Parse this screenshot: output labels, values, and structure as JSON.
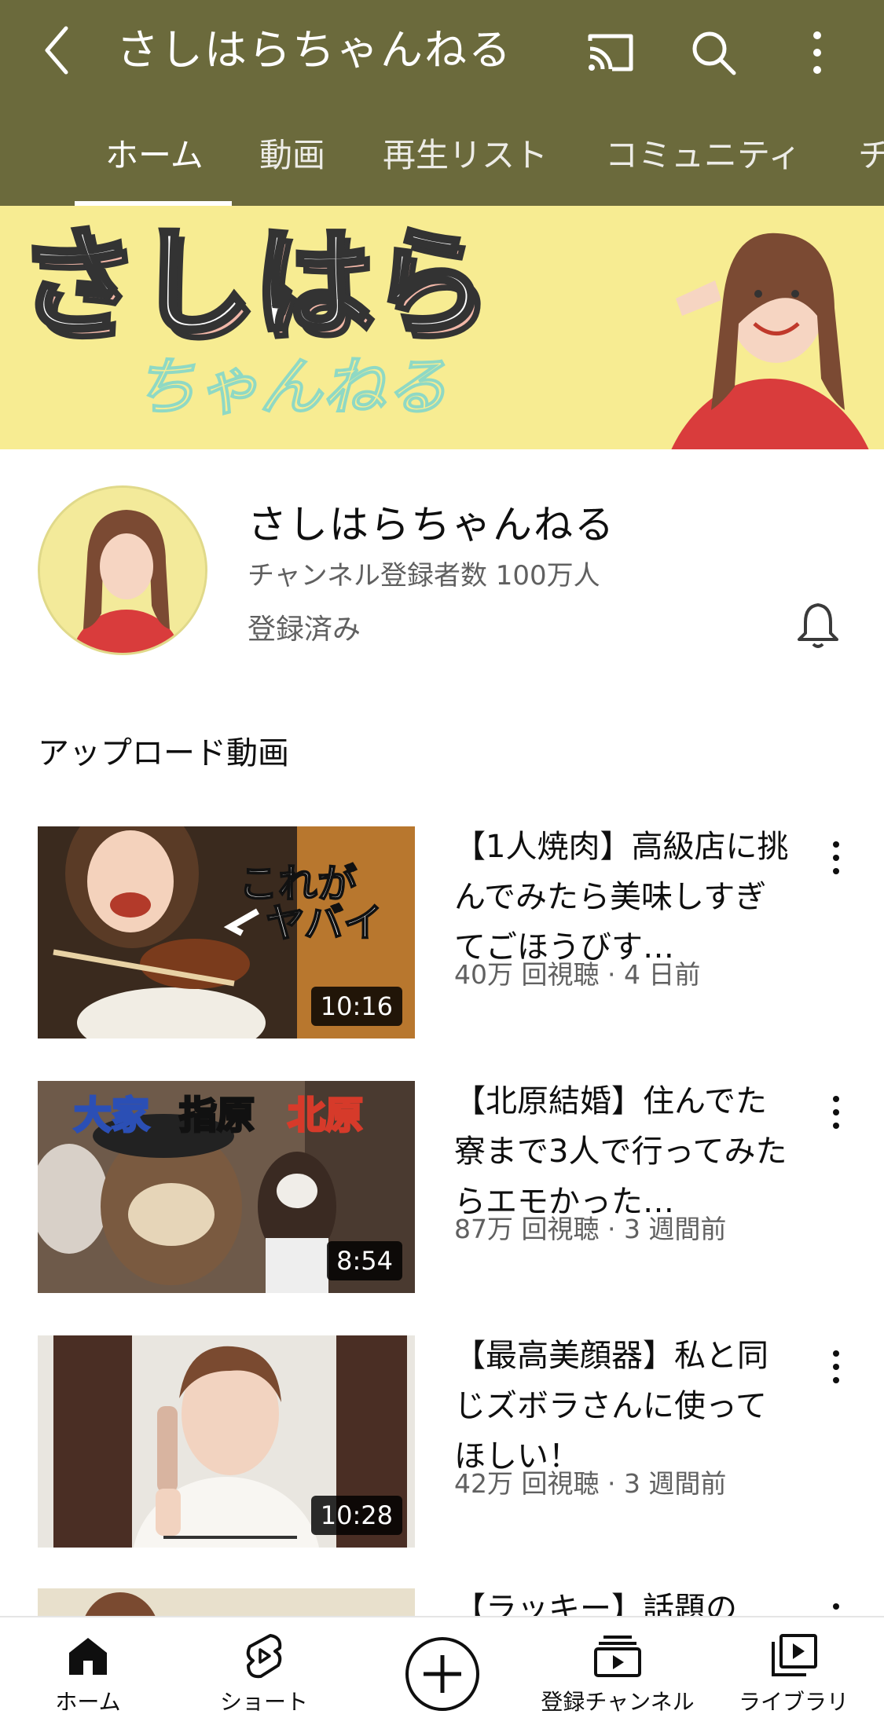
{
  "header": {
    "title": "さしはらちゃんねる",
    "back_icon": "chevron-left-icon",
    "cast_icon": "cast-icon",
    "search_icon": "search-icon",
    "more_icon": "more-vertical-icon",
    "background_color": "#6b6a3c"
  },
  "tabs": [
    {
      "label": "ホーム",
      "active": true
    },
    {
      "label": "動画"
    },
    {
      "label": "再生リスト"
    },
    {
      "label": "コミュニティ"
    },
    {
      "label": "チ"
    }
  ],
  "banner": {
    "logo_text": "さしはら",
    "logo_script": "ちゃんねる",
    "background_color": "#f7ec92"
  },
  "channel": {
    "name": "さしはらちゃんねる",
    "subscribers": "チャンネル登録者数 100万人",
    "subscribed_label": "登録済み",
    "bell_icon": "bell-icon"
  },
  "uploads": {
    "section_title": "アップロード動画",
    "videos": [
      {
        "title": "【1人焼肉】高級店に挑んでみたら美味しすぎてごほうびす…",
        "meta": "40万 回視聴 · 4 日前",
        "duration": "10:16",
        "overlay_text": [
          "これが",
          "ヤバイ"
        ]
      },
      {
        "title": "【北原結婚】住んでた寮まで3人で行ってみたらエモかった…",
        "meta": "87万 回視聴 · 3 週間前",
        "duration": "8:54",
        "overlay_text": [
          "大家",
          "指原",
          "北原"
        ]
      },
      {
        "title": "【最高美顔器】私と同じズボラさんに使ってほしい！",
        "meta": "42万 回視聴 · 3 週間前",
        "duration": "10:28"
      },
      {
        "title": "【ラッキー】話題の"
      }
    ]
  },
  "bottom_nav": [
    {
      "label": "ホーム",
      "icon": "home-icon"
    },
    {
      "label": "ショート",
      "icon": "shorts-icon"
    },
    {
      "label": "",
      "icon": "create-plus-icon"
    },
    {
      "label": "登録チャンネル",
      "icon": "subscriptions-icon"
    },
    {
      "label": "ライブラリ",
      "icon": "library-icon"
    }
  ]
}
